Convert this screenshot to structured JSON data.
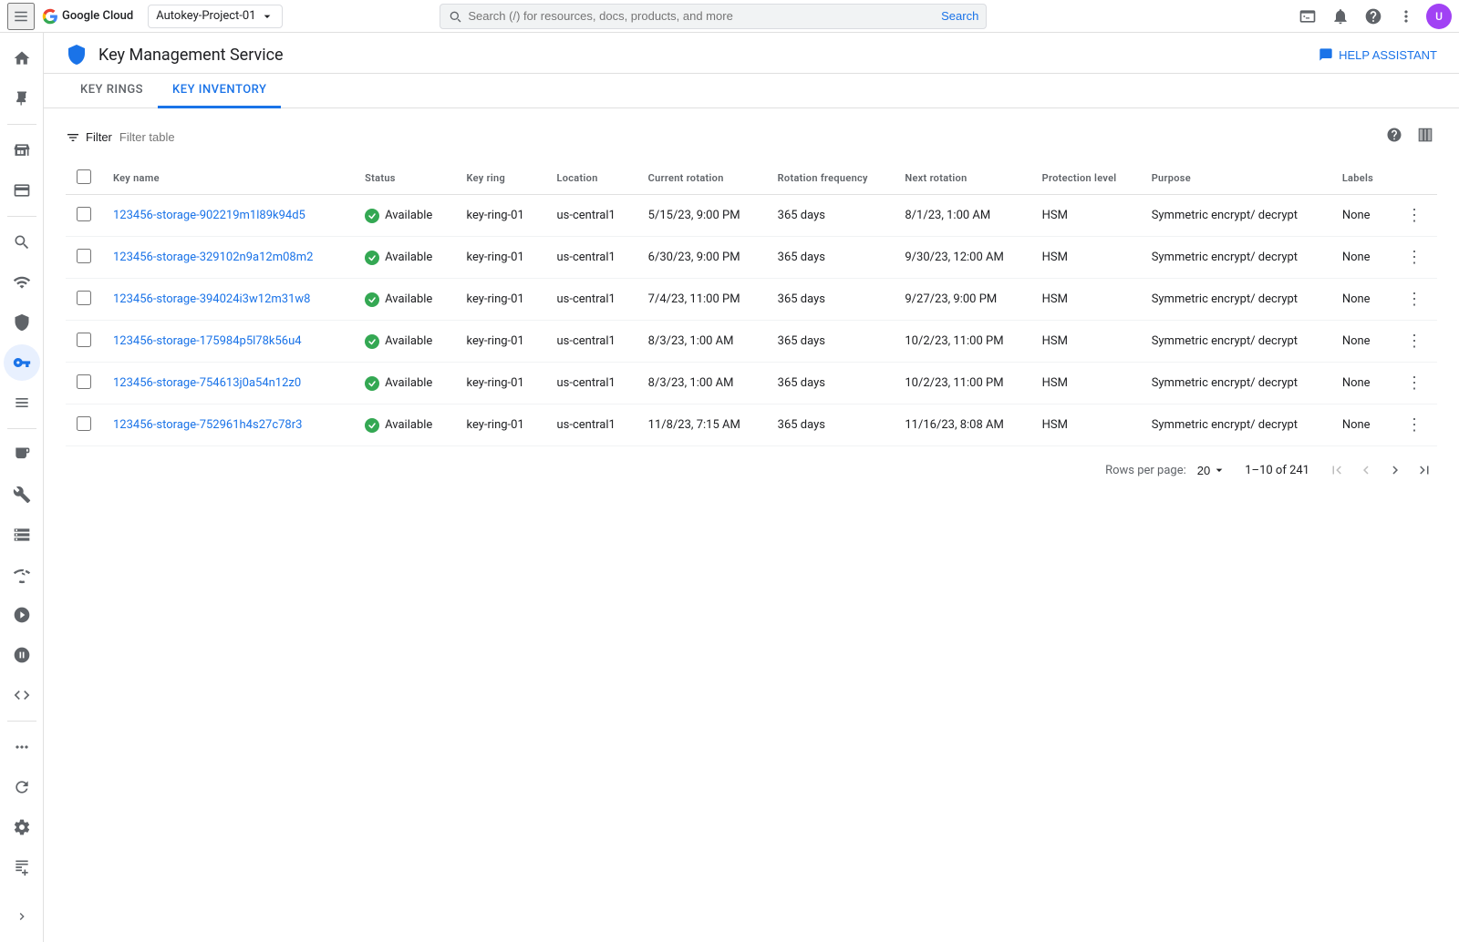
{
  "topnav": {
    "search_placeholder": "Search (/) for resources, docs, products, and more",
    "search_label": "Search",
    "project_name": "Autokey-Project-01",
    "avatar_initials": "U"
  },
  "page": {
    "title": "Key Management Service",
    "help_assistant_label": "HELP ASSISTANT"
  },
  "tabs": [
    {
      "id": "key-rings",
      "label": "KEY RINGS"
    },
    {
      "id": "key-inventory",
      "label": "KEY INVENTORY"
    }
  ],
  "active_tab": "key-inventory",
  "filter": {
    "label": "Filter",
    "placeholder": "Filter table"
  },
  "table": {
    "columns": [
      "Key name",
      "Status",
      "Key ring",
      "Location",
      "Current rotation",
      "Rotation frequency",
      "Next rotation",
      "Protection level",
      "Purpose",
      "Labels"
    ],
    "rows": [
      {
        "key_name": "123456-storage-902219m1l89k94d5",
        "status": "Available",
        "key_ring": "key-ring-01",
        "location": "us-central1",
        "current_rotation": "5/15/23, 9:00 PM",
        "rotation_frequency": "365 days",
        "next_rotation": "8/1/23, 1:00 AM",
        "protection_level": "HSM",
        "purpose": "Symmetric encrypt/ decrypt",
        "labels": "None"
      },
      {
        "key_name": "123456-storage-329102n9a12m08m2",
        "status": "Available",
        "key_ring": "key-ring-01",
        "location": "us-central1",
        "current_rotation": "6/30/23, 9:00 PM",
        "rotation_frequency": "365 days",
        "next_rotation": "9/30/23, 12:00 AM",
        "protection_level": "HSM",
        "purpose": "Symmetric encrypt/ decrypt",
        "labels": "None"
      },
      {
        "key_name": "123456-storage-394024i3w12m31w8",
        "status": "Available",
        "key_ring": "key-ring-01",
        "location": "us-central1",
        "current_rotation": "7/4/23, 11:00 PM",
        "rotation_frequency": "365 days",
        "next_rotation": "9/27/23, 9:00 PM",
        "protection_level": "HSM",
        "purpose": "Symmetric encrypt/ decrypt",
        "labels": "None"
      },
      {
        "key_name": "123456-storage-175984p5l78k56u4",
        "status": "Available",
        "key_ring": "key-ring-01",
        "location": "us-central1",
        "current_rotation": "8/3/23, 1:00 AM",
        "rotation_frequency": "365 days",
        "next_rotation": "10/2/23, 11:00 PM",
        "protection_level": "HSM",
        "purpose": "Symmetric encrypt/ decrypt",
        "labels": "None"
      },
      {
        "key_name": "123456-storage-754613j0a54n12z0",
        "status": "Available",
        "key_ring": "key-ring-01",
        "location": "us-central1",
        "current_rotation": "8/3/23, 1:00 AM",
        "rotation_frequency": "365 days",
        "next_rotation": "10/2/23, 11:00 PM",
        "protection_level": "HSM",
        "purpose": "Symmetric encrypt/ decrypt",
        "labels": "None"
      },
      {
        "key_name": "123456-storage-752961h4s27c78r3",
        "status": "Available",
        "key_ring": "key-ring-01",
        "location": "us-central1",
        "current_rotation": "11/8/23, 7:15 AM",
        "rotation_frequency": "365 days",
        "next_rotation": "11/16/23, 8:08 AM",
        "protection_level": "HSM",
        "purpose": "Symmetric encrypt/ decrypt",
        "labels": "None"
      }
    ]
  },
  "pagination": {
    "rows_per_page_label": "Rows per page:",
    "rows_per_page": "20",
    "page_info": "1–10 of 241"
  }
}
